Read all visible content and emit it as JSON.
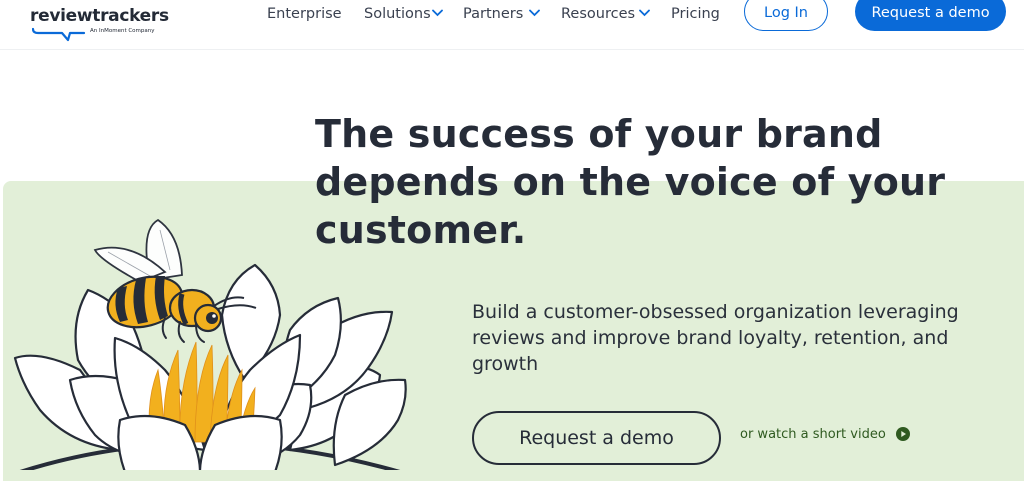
{
  "header": {
    "logo": {
      "name": "reviewtrackers",
      "tagline": "An InMoment Company"
    },
    "nav": [
      {
        "label": "Enterprise",
        "has_dropdown": false
      },
      {
        "label": "Solutions",
        "has_dropdown": true
      },
      {
        "label": "Partners",
        "has_dropdown": true
      },
      {
        "label": "Resources",
        "has_dropdown": true
      },
      {
        "label": "Pricing",
        "has_dropdown": false
      }
    ],
    "login_label": "Log In",
    "demo_label": "Request a demo"
  },
  "hero": {
    "headline": "The success of your brand depends on the voice of your customer.",
    "subheadline": "Build a customer-obsessed organization leveraging reviews and improve brand loyalty, retention, and growth",
    "cta_label": "Request a demo",
    "video_link_label": "or watch a short video"
  },
  "icons": {
    "chevron": "chevron-down-icon",
    "play": "play-circle-icon",
    "illustration": "bee-on-flower-illustration"
  },
  "colors": {
    "brand_blue": "#0a6ad8",
    "hero_bg": "#e2efd8",
    "text_dark": "#262c38",
    "link_green": "#2f5a20",
    "bee_yellow": "#f2b01e"
  }
}
